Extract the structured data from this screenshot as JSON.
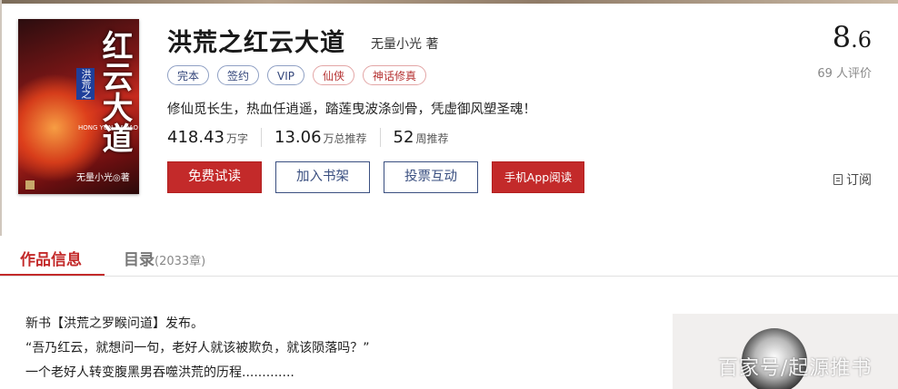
{
  "book": {
    "title": "洪荒之红云大道",
    "author": "无量小光 著",
    "cover": {
      "main_title": "红云大道",
      "banner": "洪荒之",
      "english": "HONG YUN DADAO",
      "author": "无量小光◎著"
    },
    "tags": [
      "完本",
      "签约",
      "VIP",
      "仙侠",
      "神话修真"
    ],
    "intro": "修仙觅长生，热血任逍遥，踏莲曳波涤剑骨，凭虚御风塑圣魂！",
    "stats": [
      {
        "num": "418.43",
        "unit": "万字"
      },
      {
        "num": "13.06",
        "unit": "万总推荐"
      },
      {
        "num": "52",
        "unit": "周推荐"
      }
    ],
    "buttons": {
      "free_read": "免费试读",
      "add_shelf": "加入书架",
      "vote": "投票互动",
      "app_read": "手机App阅读"
    },
    "score_int": "8",
    "score_dec": ".6",
    "rating_count": "69 人评价",
    "subscribe": "订阅"
  },
  "tabs": {
    "info": "作品信息",
    "catalog": "目录",
    "catalog_count": "(2033章)"
  },
  "description": [
    "新书【洪荒之罗睺问道】发布。",
    "“吾乃红云，就想问一句，老好人就该被欺负，就该陨落吗？”",
    "一个老好人转变腹黑男吞噬洪荒的历程............."
  ],
  "watermark": "百家号/起源推书",
  "colors": {
    "accent": "#c32a2a",
    "outline_blue": "#3a4f80"
  }
}
